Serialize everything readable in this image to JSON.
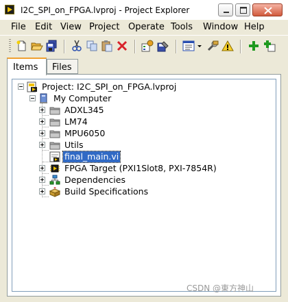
{
  "window": {
    "title": "I2C_SPI_on_FPGA.lvproj - Project Explorer",
    "minimize_icon": "minimize-icon",
    "maximize_icon": "maximize-icon",
    "close_icon": "close-icon"
  },
  "menu": [
    "File",
    "Edit",
    "View",
    "Project",
    "Operate",
    "Tools",
    "Window",
    "Help"
  ],
  "toolbar": {
    "icons": [
      "new-icon",
      "open-icon",
      "save-all-icon",
      "cut-icon",
      "copy-icon",
      "paste-icon",
      "delete-icon",
      "properties-icon",
      "build-icon",
      "view-icon",
      "dropdown-icon",
      "wrench-icon",
      "warning-icon",
      "add-icon",
      "add-file-icon"
    ]
  },
  "tabs": {
    "items": "Items",
    "files": "Files"
  },
  "tree": {
    "project": "Project: I2C_SPI_on_FPGA.lvproj",
    "my_computer": "My Computer",
    "folders": [
      "ADXL345",
      "LM74",
      "MPU6050",
      "Utils"
    ],
    "selected_vi": "final_main.vi",
    "fpga_target": "FPGA Target (PXI1Slot8, PXI-7854R)",
    "dependencies": "Dependencies",
    "build_specifications": "Build Specifications"
  },
  "watermark": "CSDN @東方神山",
  "colors": {
    "selection": "#316ac5",
    "window_bg": "#ece9d8",
    "close_button": "#d05a3c"
  }
}
